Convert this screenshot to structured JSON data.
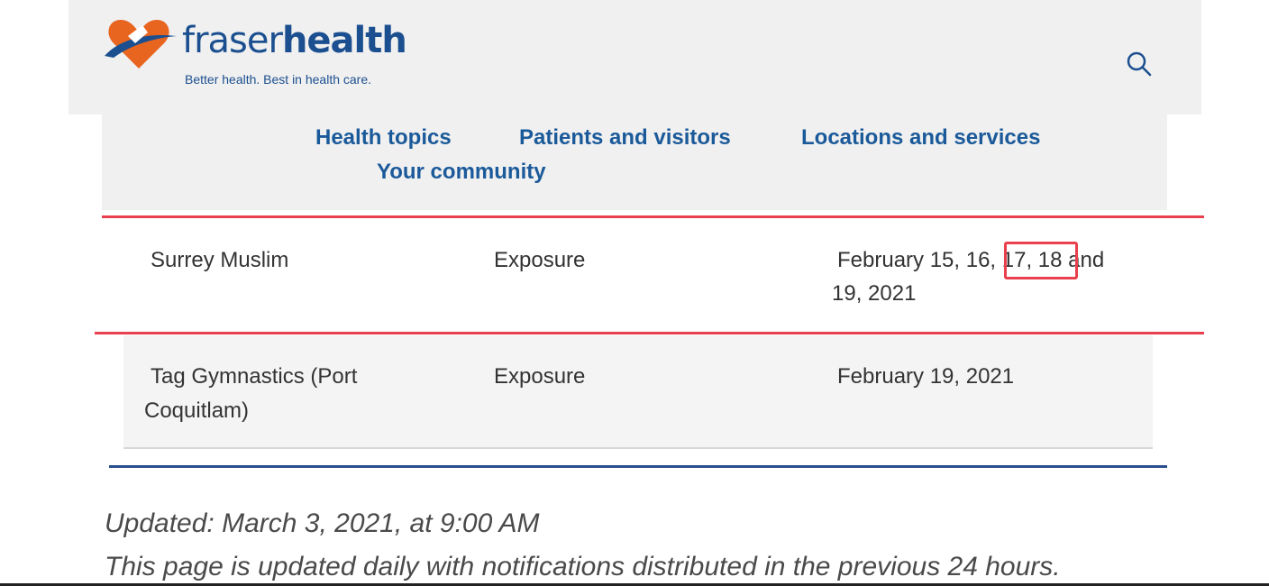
{
  "header": {
    "logo": {
      "name_light": "fraser",
      "name_bold": "health",
      "tagline": "Better health. Best in health care."
    },
    "search_icon": "search-icon"
  },
  "nav": {
    "items": [
      "Health topics",
      "Patients and visitors",
      "Locations and services",
      "Your community"
    ]
  },
  "table": {
    "rows": [
      {
        "name": "Surrey Muslim",
        "type": "Exposure",
        "dates_a": "February 15, 16, 17, 18 and",
        "dates_b": "19, 2021"
      },
      {
        "name_a": "Tag Gymnastics (Port",
        "name_b": "Coquitlam)",
        "type": "Exposure",
        "dates": "February 19, 2021"
      }
    ]
  },
  "footer": {
    "updated": "Updated: March 3, 2021, at 9:00 AM",
    "note": "This page is updated daily with notifications distributed in the previous 24 hours."
  },
  "colors": {
    "brand_blue": "#1b5a9a",
    "logo_orange": "#e8651f",
    "highlight_red": "#e8414d"
  }
}
